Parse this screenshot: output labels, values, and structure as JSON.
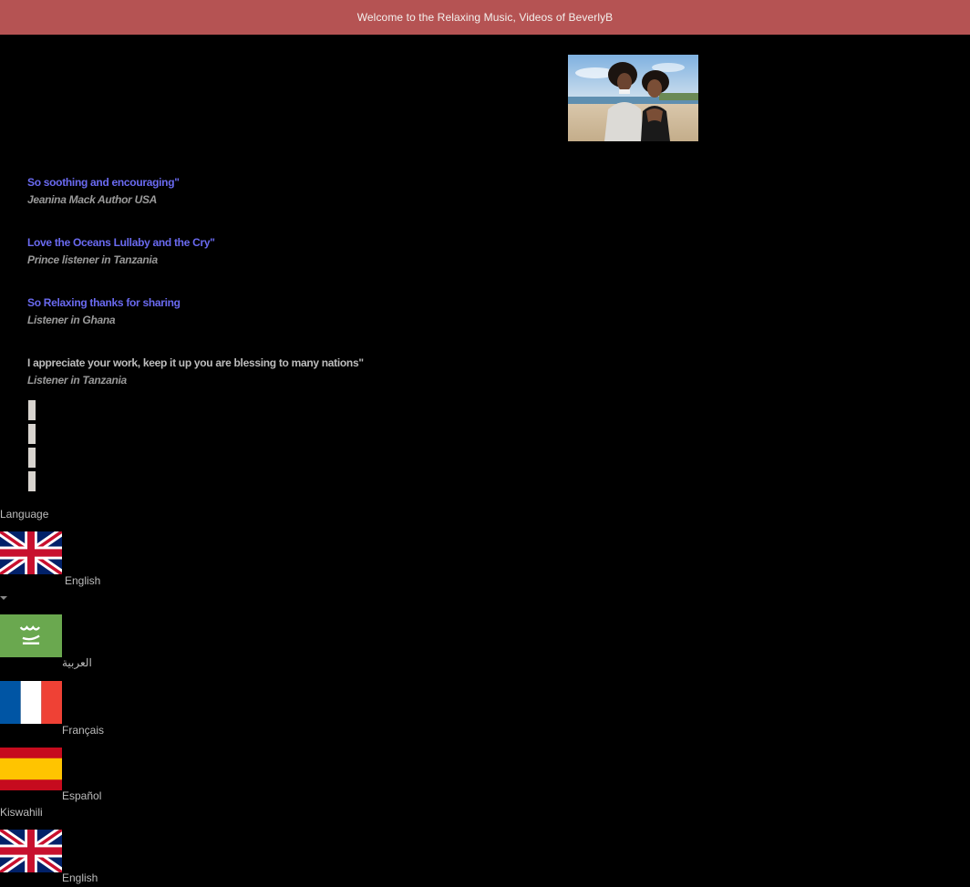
{
  "announcement": "Welcome to the Relaxing Music, Videos of BeverlyB",
  "hero_image": {
    "alt": "Two women smiling on a beach"
  },
  "testimonials": [
    {
      "quote": "So soothing and encouraging\"",
      "author": "Jeanina Mack Author USA",
      "accent": "#6a6af0"
    },
    {
      "quote": "Love the Oceans Lullaby and the Cry\"",
      "author": "Prince listener in Tanzania",
      "accent": "#6a6af0"
    },
    {
      "quote": "So Relaxing thanks for sharing",
      "author": "Listener in Ghana",
      "accent": "#6a6af0"
    },
    {
      "quote": "I appreciate your work, keep it up you are blessing to many nations\"",
      "author": "Listener in Tanzania",
      "accent": "#bdbdbd"
    }
  ],
  "language_switcher": {
    "title": "Language",
    "current": {
      "label": "English",
      "flag": "uk-flag"
    },
    "options": [
      {
        "label": "العربية",
        "flag": "saudi-flag"
      },
      {
        "label": "Français",
        "flag": "france-flag"
      },
      {
        "label": "Español",
        "flag": "spain-flag"
      },
      {
        "label": "Kiswahili",
        "flag": ""
      },
      {
        "label": "English",
        "flag": "uk-flag"
      }
    ]
  },
  "colors": {
    "announcement_bg": "#b55353",
    "page_bg": "#000000",
    "quote_accent": "#6a6af0"
  }
}
